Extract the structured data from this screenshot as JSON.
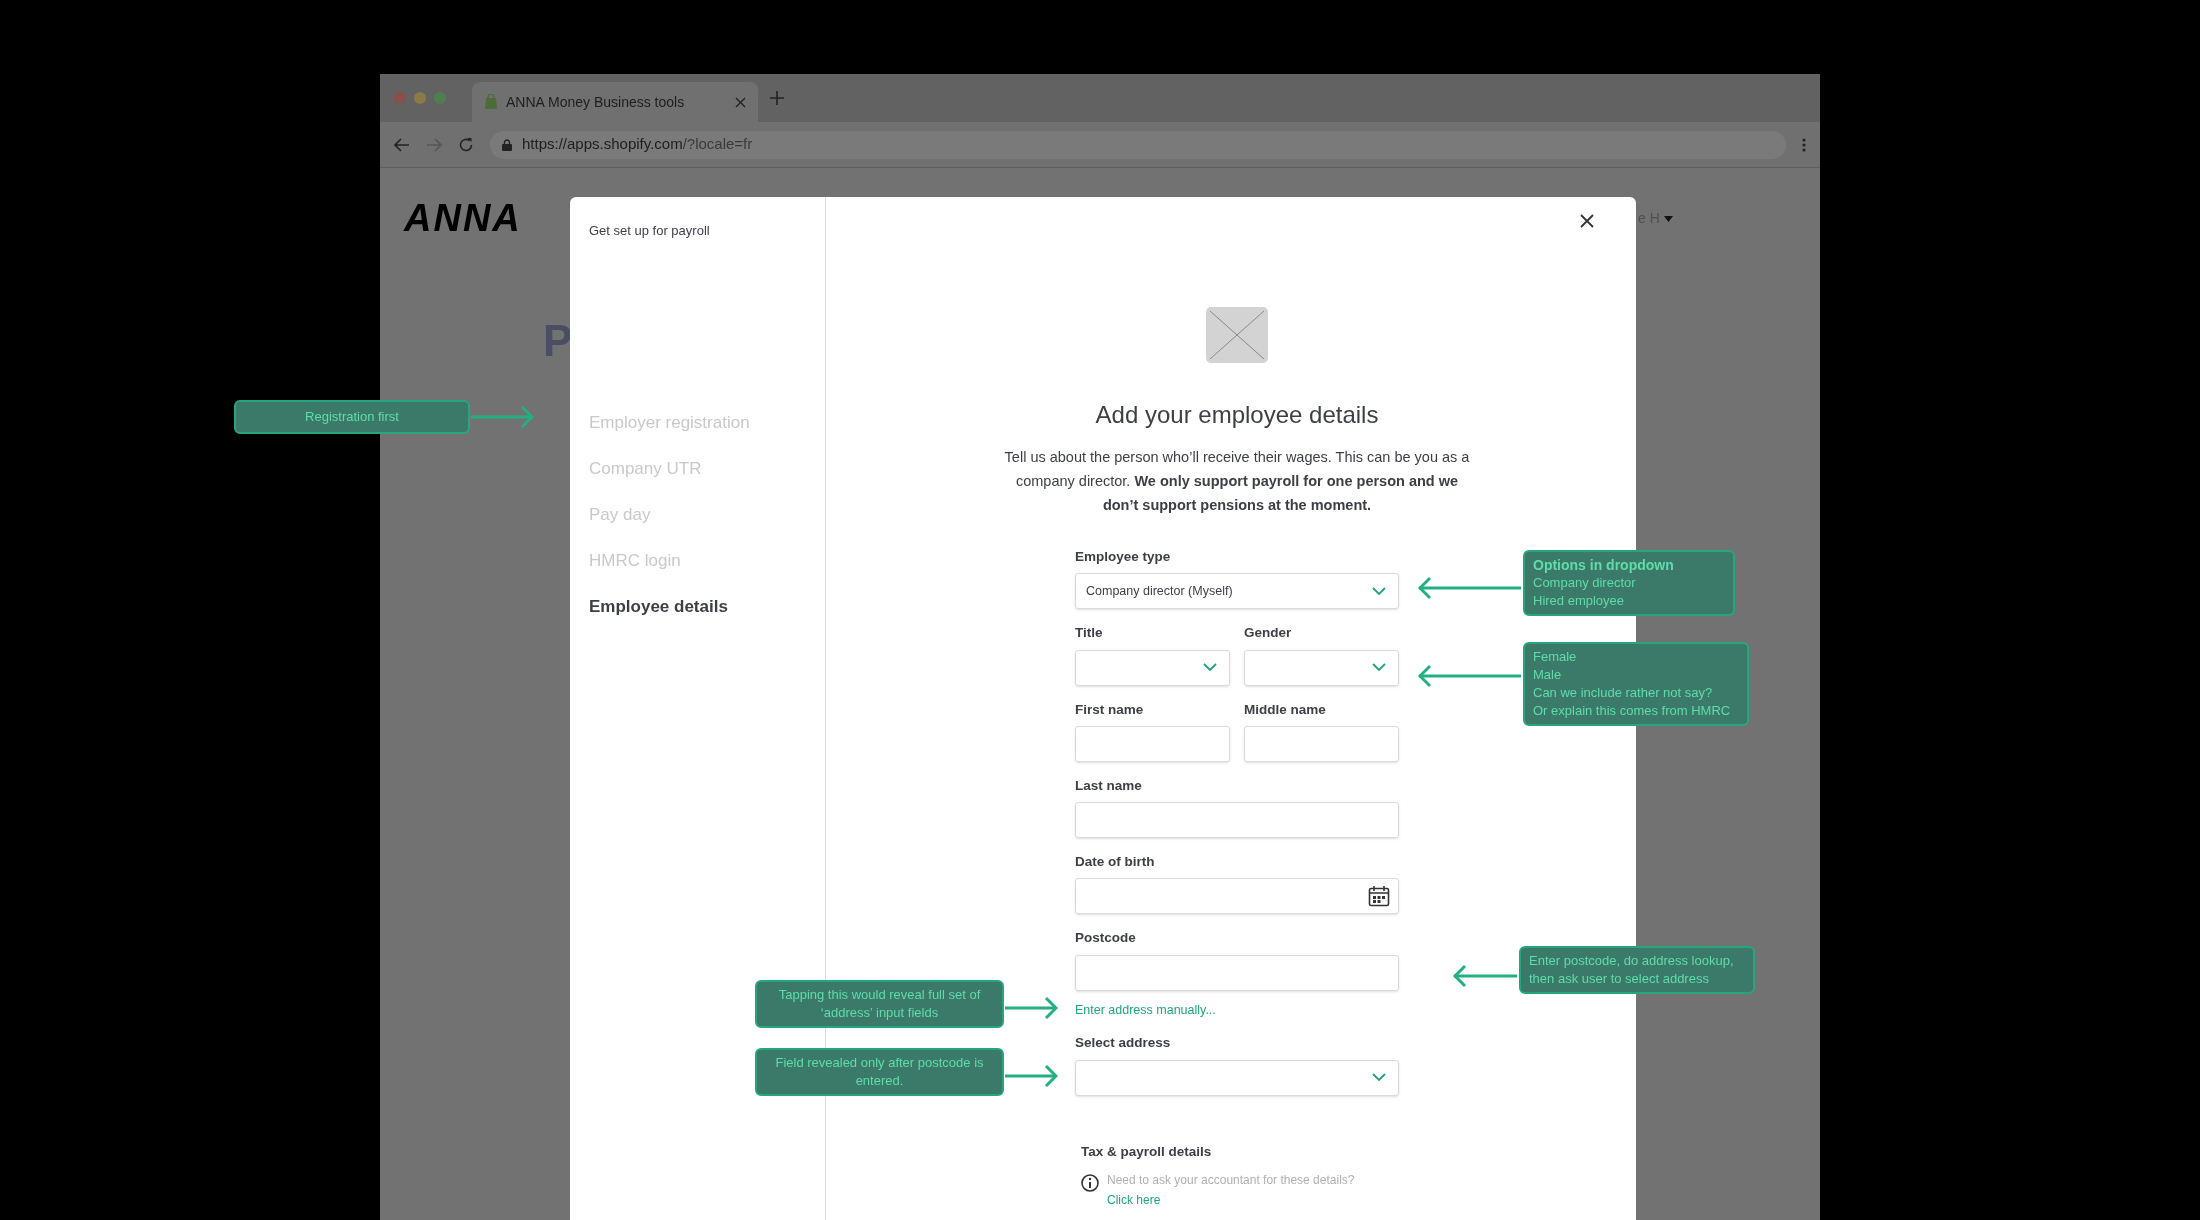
{
  "browser": {
    "tab": {
      "title": "ANNA Money Business tools",
      "selected": true
    },
    "url_host": "https://apps.shopify.com",
    "url_path": "/?locale=fr"
  },
  "page": {
    "logo": "ANNA",
    "heading_fragment": "P",
    "user_menu": "e H"
  },
  "modal": {
    "sidebar_title": "Get set up for payroll",
    "steps": [
      {
        "label": "Employer registration",
        "selected": false
      },
      {
        "label": "Company UTR",
        "selected": false
      },
      {
        "label": "Pay day",
        "selected": false
      },
      {
        "label": "HMRC login",
        "selected": false
      },
      {
        "label": "Employee details",
        "selected": true
      }
    ],
    "heading": "Add your employee details",
    "intro": "Tell us about the person who’ll receive their wages. This can be you as a company director. **We only support payroll for one person and we don’t support pensions at the moment.**",
    "rows": [
      [
        {
          "kind": "select",
          "label": "Employee type",
          "value": "Company director (Myself)"
        }
      ],
      [
        {
          "kind": "select",
          "label": "Title"
        },
        {
          "kind": "select",
          "label": "Gender"
        }
      ],
      [
        {
          "kind": "text",
          "label": "First name"
        },
        {
          "kind": "text",
          "label": "Middle name"
        }
      ],
      [
        {
          "kind": "text",
          "label": "Last name"
        }
      ],
      [
        {
          "kind": "date",
          "label": "Date of birth"
        }
      ],
      [
        {
          "kind": "text",
          "label": "Postcode",
          "link": "Enter address manually..."
        }
      ],
      [
        {
          "kind": "select",
          "label": "Select address"
        }
      ]
    ],
    "tax": {
      "heading": "Tax & payroll details",
      "note": "Need to ask your accountant for these details?",
      "link": "Click here"
    }
  },
  "annotations": [
    {
      "text": "Registration first"
    },
    {
      "title": "Options in dropdown",
      "lines": [
        "Company director",
        "Hired employee"
      ]
    },
    {
      "lines": [
        "Female",
        "Male",
        "Can we include rather not say?",
        "Or explain this comes from HMRC"
      ]
    },
    {
      "text": "Enter postcode, do address lookup, then ask user to select address"
    },
    {
      "text": "Tapping this would reveal full set of ‘address’ input fields"
    },
    {
      "text": "Field revealed only after postcode is entered."
    }
  ]
}
